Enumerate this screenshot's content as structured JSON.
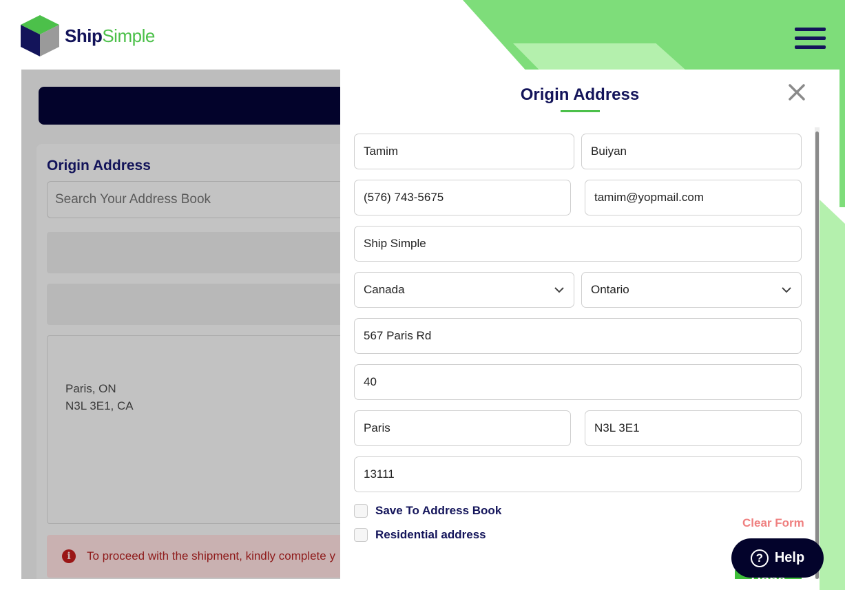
{
  "header": {
    "logo_text_part1": "Ship",
    "logo_text_part2": "Simple",
    "brand_colors": {
      "navy": "#13145a",
      "green": "#4cc04a"
    }
  },
  "background_page": {
    "section_title": "Origin Address",
    "search_placeholder": "Search Your Address Book",
    "address_line1": "Paris, ON",
    "address_line2": "N3L 3E1, CA",
    "alert_text": "To proceed with the shipment, kindly complete y"
  },
  "modal": {
    "title": "Origin Address",
    "close_icon": "close-icon",
    "fields": {
      "first_name": "Tamim",
      "last_name": "Buiyan",
      "phone": "(576) 743-5675",
      "email": "tamim@yopmail.com",
      "company": "Ship Simple",
      "country": "Canada",
      "province": "Ontario",
      "address_line1": "567 Paris Rd",
      "address_line2": "40",
      "city": "Paris",
      "postal_code": "N3L 3E1",
      "extra": "13111"
    },
    "checkboxes": {
      "save_to_address_book": "Save To Address Book",
      "residential_address": "Residential address"
    },
    "clear_form_label": "Clear Form",
    "done_label": "Done"
  },
  "help": {
    "icon": "question-circle-icon",
    "label": "Help"
  }
}
